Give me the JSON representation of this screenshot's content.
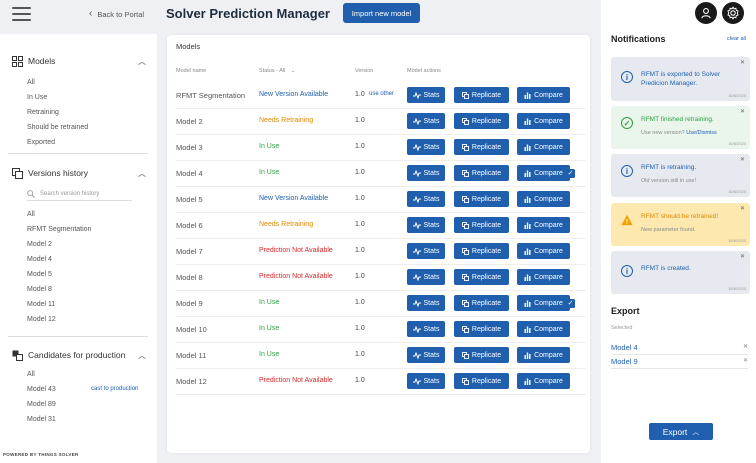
{
  "header": {
    "back_label": "Back to Portal",
    "title": "Solver Prediction Manager",
    "import_button": "Import new model"
  },
  "sidebar": {
    "models": {
      "title": "Models",
      "items": [
        "All",
        "In Use",
        "Retraining",
        "Should be retrained",
        "Exported"
      ]
    },
    "versions": {
      "title": "Versions history",
      "search_placeholder": "Search version history",
      "items": [
        "All",
        "RFMT Segmentation",
        "Model 2",
        "Model 4",
        "Model 5",
        "Model 8",
        "Model 11",
        "Model 12"
      ]
    },
    "candidates": {
      "title": "Candidates for production",
      "items": [
        "All",
        "Model 43",
        "Model 89",
        "Model 31"
      ],
      "cast_label": "cast to production"
    },
    "powered_by": "POWERED BY THINGS SOLVER"
  },
  "main": {
    "title": "Models",
    "columns": {
      "name": "Model name",
      "status": "Status - All",
      "version": "Version",
      "actions": "Model actions"
    },
    "use_other": "use other",
    "buttons": {
      "stats": "Stats",
      "replicate": "Replicate",
      "compare": "Compare"
    },
    "rows": [
      {
        "name": "RFMT Segmentation",
        "status": "New Version Available",
        "status_color": "#1f5fae",
        "version": "1.0",
        "use_other": true,
        "checked": false
      },
      {
        "name": "Model 2",
        "status": "Needs Retraining",
        "status_color": "#e08a00",
        "version": "1.0",
        "use_other": false,
        "checked": false
      },
      {
        "name": "Model 3",
        "status": "In Use",
        "status_color": "#2e9e3e",
        "version": "1.0",
        "use_other": false,
        "checked": false
      },
      {
        "name": "Model 4",
        "status": "In Use",
        "status_color": "#2e9e3e",
        "version": "1.0",
        "use_other": false,
        "checked": true
      },
      {
        "name": "Model 5",
        "status": "New Version Available",
        "status_color": "#1f5fae",
        "version": "1.0",
        "use_other": false,
        "checked": false
      },
      {
        "name": "Model 6",
        "status": "Needs Retraining",
        "status_color": "#e08a00",
        "version": "1.0",
        "use_other": false,
        "checked": false
      },
      {
        "name": "Model 7",
        "status": "Prediction Not Available",
        "status_color": "#d62b2b",
        "version": "1.0",
        "use_other": false,
        "checked": false
      },
      {
        "name": "Model 8",
        "status": "Prediction Not Available",
        "status_color": "#d62b2b",
        "version": "1.0",
        "use_other": false,
        "checked": false
      },
      {
        "name": "Model 9",
        "status": "In Use",
        "status_color": "#2e9e3e",
        "version": "1.0",
        "use_other": false,
        "checked": true
      },
      {
        "name": "Model 10",
        "status": "In Use",
        "status_color": "#2e9e3e",
        "version": "1.0",
        "use_other": false,
        "checked": false
      },
      {
        "name": "Model 11",
        "status": "In Use",
        "status_color": "#2e9e3e",
        "version": "1.0",
        "use_other": false,
        "checked": false
      },
      {
        "name": "Model 12",
        "status": "Prediction Not Available",
        "status_color": "#d62b2b",
        "version": "1.0",
        "use_other": false,
        "checked": false
      }
    ]
  },
  "notifications": {
    "title": "Notifications",
    "clear_all": "clear all",
    "items": [
      {
        "type": "info",
        "text": "RFMT is exported to Solver Predicion Manager.",
        "sub": "",
        "date": "16/6/2020"
      },
      {
        "type": "success",
        "text": "RFMT finished retraining.",
        "sub": "Use new version?",
        "sub_link": "Use/Dismiss",
        "date": "16/6/2020"
      },
      {
        "type": "info",
        "text": "RFMT is retraining.",
        "sub": "Old version still in use!",
        "date": "16/6/2020"
      },
      {
        "type": "warning",
        "text": "RFMT should be retrained!",
        "sub": "New parameter found.",
        "date": "16/6/2020"
      },
      {
        "type": "info",
        "text": "RFMT is created.",
        "sub": "",
        "date": "16/6/2020"
      }
    ]
  },
  "export": {
    "title": "Export",
    "selected_label": "Selected",
    "items": [
      "Model 4",
      "Model 9"
    ],
    "button": "Export"
  },
  "colors": {
    "accent": "#1f5fae",
    "success_bg": "#eaf6ec",
    "warning_bg": "#fde8b0",
    "info_bg": "#e6eaf0"
  }
}
